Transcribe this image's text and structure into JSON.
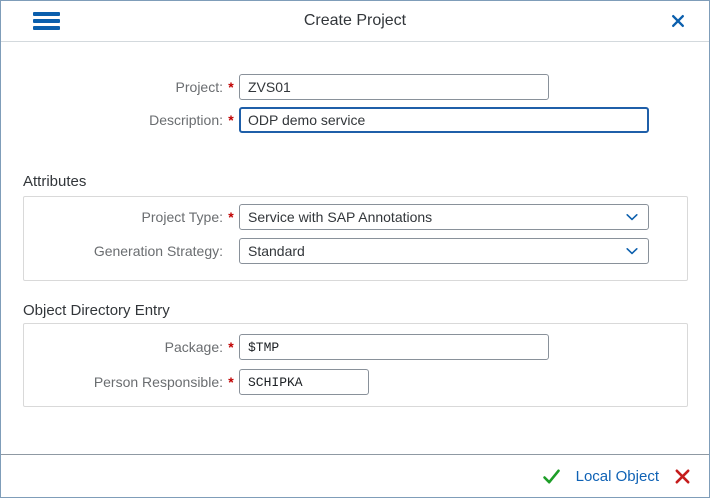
{
  "title_bar": {
    "title": "Create Project"
  },
  "required_marker": "*",
  "form": {
    "project": {
      "label": "Project:",
      "required": true,
      "value": "ZVS01"
    },
    "description": {
      "label": "Description:",
      "required": true,
      "value": "ODP demo service",
      "focused": true
    }
  },
  "attributes_section": {
    "heading": "Attributes",
    "project_type": {
      "label": "Project Type:",
      "required": true,
      "value": "Service with SAP Annotations"
    },
    "generation_strategy": {
      "label": "Generation Strategy:",
      "required": false,
      "value": "Standard"
    }
  },
  "object_directory_section": {
    "heading": "Object Directory Entry",
    "package": {
      "label": "Package:",
      "required": true,
      "value": "$TMP"
    },
    "person_responsible": {
      "label": "Person Responsible:",
      "required": true,
      "value": "SCHIPKA"
    }
  },
  "footer": {
    "local_object_label": "Local Object"
  },
  "icons": {
    "menu": "hamburger-menu-icon",
    "close": "close-icon",
    "dropdown": "chevron-down-icon",
    "confirm": "check-icon",
    "cancel": "x-icon"
  },
  "colors": {
    "accent_blue": "#0b5fad",
    "link_blue": "#0f62b5",
    "focused_border_blue": "#1f5fa9",
    "positive_green": "#1e9e28",
    "negative_red": "#c51c1c",
    "required_red": "#c00000",
    "dialog_border": "#7f9db9",
    "input_border": "#89919a",
    "label_gray": "#6a6d70",
    "text_dark": "#32363a"
  }
}
